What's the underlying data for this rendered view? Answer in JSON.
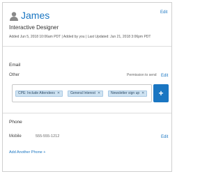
{
  "header": {
    "name": "James",
    "job_title": "Interactive Designer",
    "edit_label": "Edit",
    "meta": "Added Jun 5, 2018 10:06am PDT | Added by you | Last Updated: Jun 21, 2018 3:06pm PDT"
  },
  "email": {
    "heading": "Email",
    "sub_label": "Other",
    "permission_label": "Permission to send",
    "edit_label": "Edit",
    "tags": [
      {
        "label": "CPE: Include Attendees"
      },
      {
        "label": "General Interest"
      },
      {
        "label": "Newsletter sign up"
      }
    ],
    "add_button_label": "+"
  },
  "phone": {
    "heading": "Phone",
    "sub_label": "Mobile",
    "number": "555-555-1212",
    "edit_label": "Edit",
    "add_another_label": "Add Another Phone +"
  },
  "colors": {
    "accent": "#1a76c2",
    "tag_bg": "#cfe3f2"
  }
}
